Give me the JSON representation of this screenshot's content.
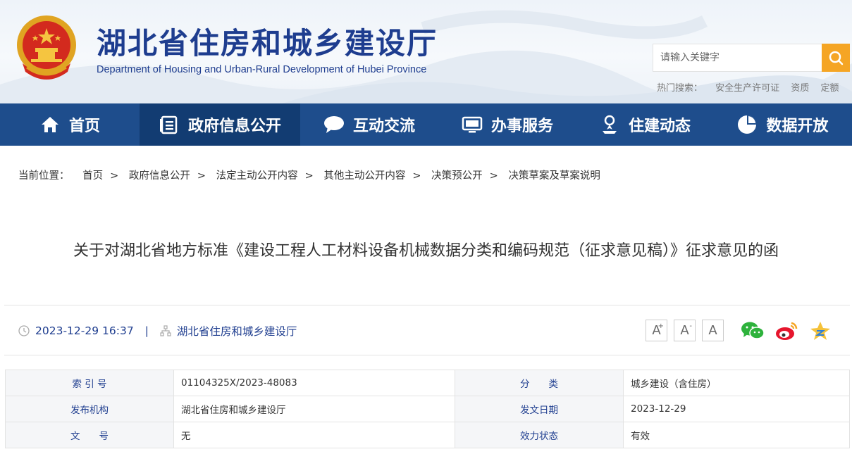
{
  "header": {
    "title": "湖北省住房和城乡建设厅",
    "subtitle": "Department of Housing and Urban-Rural Development of Hubei Province",
    "search_placeholder": "请输入关键字",
    "hot_label": "热门搜索：",
    "hot_keywords": [
      "安全生产许可证",
      "资质",
      "定额"
    ]
  },
  "nav": {
    "items": [
      {
        "label": "首页",
        "icon": "home-icon"
      },
      {
        "label": "政府信息公开",
        "icon": "document-list-icon"
      },
      {
        "label": "互动交流",
        "icon": "chat-bubble-icon"
      },
      {
        "label": "办事服务",
        "icon": "monitor-icon"
      },
      {
        "label": "住建动态",
        "icon": "person-pin-icon"
      },
      {
        "label": "数据开放",
        "icon": "pie-chart-icon"
      }
    ],
    "active_index": 1
  },
  "breadcrumb": {
    "label": "当前位置：",
    "items": [
      "首页",
      "政府信息公开",
      "法定主动公开内容",
      "其他主动公开内容",
      "决策预公开",
      "决策草案及草案说明"
    ]
  },
  "article": {
    "title": "关于对湖北省地方标准《建设工程人工材料设备机械数据分类和编码规范（征求意见稿）》征求意见的函",
    "datetime": "2023-12-29 16:37",
    "separator": "|",
    "source": "湖北省住房和城乡建设厅"
  },
  "font_buttons": {
    "increase": "A",
    "decrease": "A",
    "reset": "A",
    "increase_sup": "+",
    "decrease_sup": "-"
  },
  "share": [
    "wechat-icon",
    "weibo-icon",
    "qzone-icon"
  ],
  "info_table": {
    "rows": [
      {
        "k1": "索 引 号",
        "v1": "01104325X/2023-48083",
        "k2": "分　　类",
        "v2": "城乡建设（含住房）"
      },
      {
        "k1": "发布机构",
        "v1": "湖北省住房和城乡建设厅",
        "k2": "发文日期",
        "v2": "2023-12-29"
      },
      {
        "k1": "文　　号",
        "v1": "无",
        "k2": "效力状态",
        "v2": "有效"
      }
    ]
  },
  "colors": {
    "brand_blue": "#1e4d8c",
    "nav_active": "#123c72",
    "title_blue": "#1e3d8f",
    "search_orange": "#f5a524"
  }
}
